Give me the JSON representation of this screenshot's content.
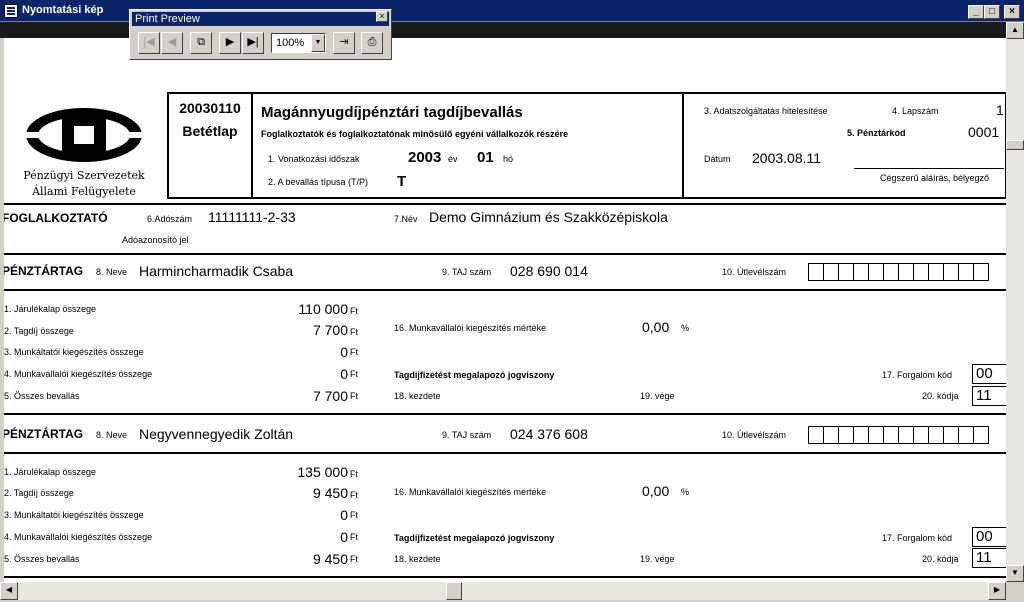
{
  "window": {
    "title": "Nyomtatási kép"
  },
  "preview_toolbar": {
    "title": "Print Preview",
    "zoom": "100%"
  },
  "header": {
    "org_line1": "Pénzügyi Szervezetek",
    "org_line2": "Állami Felügyelete",
    "form_code": "20030110",
    "form_sub": "Betétlap",
    "form_title": "Magánnyugdíjpénztári tagdíjbevallás",
    "form_subtitle": "Foglalkoztatók és foglalkoztatónak minősülő egyéni vállalkozók részére",
    "period_label": "1. Vonatkozási időszak",
    "year": "2003",
    "year_unit": "év",
    "month": "01",
    "month_unit": "hó",
    "type_label": "2. A bevallás típusa (T/P)",
    "type_value": "T",
    "auth_label": "3. Adatszolgáltatás hitelesítése",
    "page_label": "4. Lapszám",
    "page_value": "1",
    "fund_code_label": "5. Pénztárkód",
    "fund_code_value": "0001",
    "date_label": "Dátum",
    "date_value": "2003.08.11",
    "signature_label": "Cégszerű aláírás, bélyegző"
  },
  "employer": {
    "section": "FOGLALKOZTATÓ",
    "tax_label": "6.Adószám",
    "tax_value": "11111111-2-33",
    "tax_caption": "Adóazonosító jel",
    "name_label": "7.Név",
    "name_value": "Demo Gimnázium és Szakközépiskola"
  },
  "labels": {
    "member_section": "PÉNZTÁRTAG",
    "name": "8. Neve",
    "taj": "9. TAJ szám",
    "passport": "10. Útlevélszám",
    "f1": "1. Járulékalap összege",
    "f2": "2. Tagdíj összege",
    "f3": "3. Munkáltatói kiegészítés összege",
    "f4": "4. Munkavállalói kiegészítés összege",
    "f5": "5. Összes bevallás",
    "f16": "16. Munkavállalói kiegészítés mértéke",
    "relation": "Tagdíjfizetést megalapozó jogviszony",
    "f17": "17. Forgalom kód",
    "f18": "18. kezdete",
    "f19": "19. vége",
    "f20": "20. kódja",
    "currency": "Ft",
    "percent": "%"
  },
  "members": [
    {
      "name": "Harmincharmadik Csaba",
      "taj": "028 690 014",
      "base": "110 000",
      "fee": "7 700",
      "employer_supp": "0",
      "employee_supp": "0",
      "total": "7 700",
      "supp_rate": "0,00",
      "traffic_code": "00",
      "rel_code": "11"
    },
    {
      "name": "Negyvennegyedik Zoltán",
      "taj": "024 376 608",
      "base": "135 000",
      "fee": "9 450",
      "employer_supp": "0",
      "employee_supp": "0",
      "total": "9 450",
      "supp_rate": "0,00",
      "traffic_code": "00",
      "rel_code": "11"
    }
  ]
}
